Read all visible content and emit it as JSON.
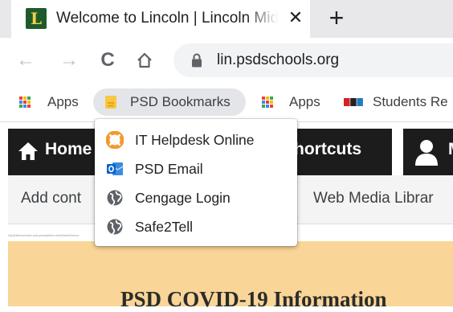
{
  "tab": {
    "title": "Welcome to Lincoln | Lincoln Middle School",
    "favicon_letter": "L",
    "close_glyph": "✕",
    "new_tab_glyph": "+"
  },
  "toolbar": {
    "back_glyph": "←",
    "forward_glyph": "→",
    "reload_glyph": "C",
    "url": "lin.psdschools.org"
  },
  "bookmarks": {
    "items": [
      {
        "label": "Apps",
        "icon": "apps-grid-icon"
      },
      {
        "label": "PSD Bookmarks",
        "icon": "folder-icon"
      },
      {
        "label": "Apps",
        "icon": "apps-grid-icon"
      },
      {
        "label": "Students Re",
        "icon": "npr-icon"
      }
    ]
  },
  "menu": {
    "items": [
      {
        "label": "IT Helpdesk Online",
        "icon": "lifebuoy-icon"
      },
      {
        "label": "PSD Email",
        "icon": "outlook-icon"
      },
      {
        "label": "Cengage Login",
        "icon": "globe-icon"
      },
      {
        "label": "Safe2Tell",
        "icon": "globe-icon"
      }
    ]
  },
  "page": {
    "nav_home": "Home",
    "nav_shortcuts": "hortcuts",
    "nav_m": "M",
    "sub_add": "Add cont",
    "sub_web": "Web Media Librar",
    "tiny_text": "Opdbbebweosbv.ssw.pswaddtes.net/MiedsDevice",
    "covid_title": "PSD COVID-19 Information"
  },
  "colors": {
    "favicon_bg": "#1f5a2b",
    "navbar_bg": "#1c1c1c",
    "covid_banner": "#f9d597",
    "lifebuoy": "#f29a2e",
    "outlook": "#0a64c8"
  }
}
